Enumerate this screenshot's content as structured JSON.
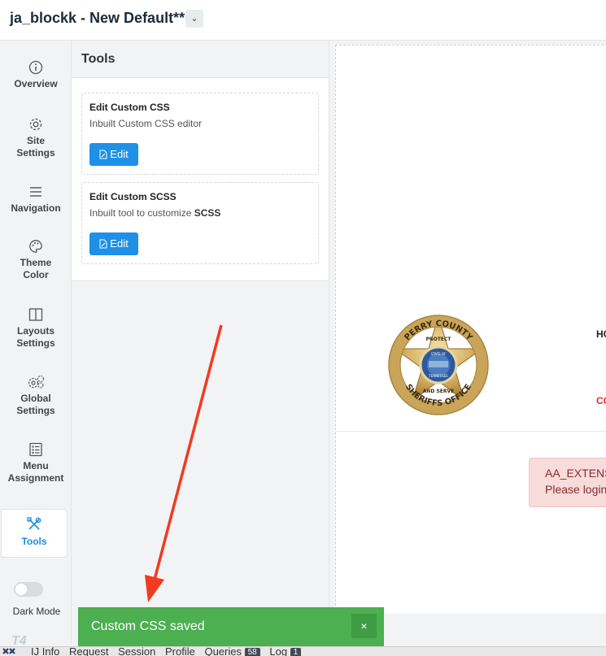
{
  "header": {
    "title": "ja_blockk - New Default**",
    "dropdown_icon": "chevron-down-icon"
  },
  "rail": {
    "items": [
      {
        "label": "Overview",
        "icon": "info-icon"
      },
      {
        "label": "Site\nSettings",
        "icon": "gear-icon"
      },
      {
        "label": "Navigation",
        "icon": "menu-icon"
      },
      {
        "label": "Theme\nColor",
        "icon": "palette-icon"
      },
      {
        "label": "Layouts\nSettings",
        "icon": "layout-icon"
      },
      {
        "label": "Global\nSettings",
        "icon": "gears-icon"
      },
      {
        "label": "Menu\nAssignment",
        "icon": "list-icon"
      },
      {
        "label": "Tools",
        "icon": "tools-icon",
        "active": true
      }
    ],
    "dark_mode_label": "Dark Mode",
    "footer_logo": "T4"
  },
  "panel": {
    "title": "Tools",
    "cards": [
      {
        "title": "Edit Custom CSS",
        "desc": "Inbuilt Custom CSS editor",
        "desc_bold": "",
        "button": "Edit"
      },
      {
        "title": "Edit Custom SCSS",
        "desc": "Inbuilt tool to customize ",
        "desc_bold": "SCSS",
        "button": "Edit"
      }
    ]
  },
  "preview": {
    "badge": {
      "top_text": "PERRY COUNTY",
      "bottom_text": "SHERIFFS OFFICE",
      "ribbon_top": "PROTECT",
      "ribbon_bottom": "AND SERVE",
      "seal_top": "STATE OF",
      "seal_bottom": "TENNESSEE"
    },
    "nav_ho": "HO",
    "nav_co": "CO",
    "alert_line1": "AA_EXTENS",
    "alert_line2": "Please login"
  },
  "toast": {
    "message": "Custom CSS saved",
    "close": "×"
  },
  "debug_bar": {
    "items": [
      "IJ Info",
      "Request",
      "Session",
      "Profile",
      "Queries",
      "Log"
    ],
    "queries_count": "58",
    "log_count": "1"
  },
  "colors": {
    "accent": "#1e90e8",
    "toast": "#4caf50",
    "alert_bg": "#f8dcdc",
    "danger": "#d9332b"
  }
}
